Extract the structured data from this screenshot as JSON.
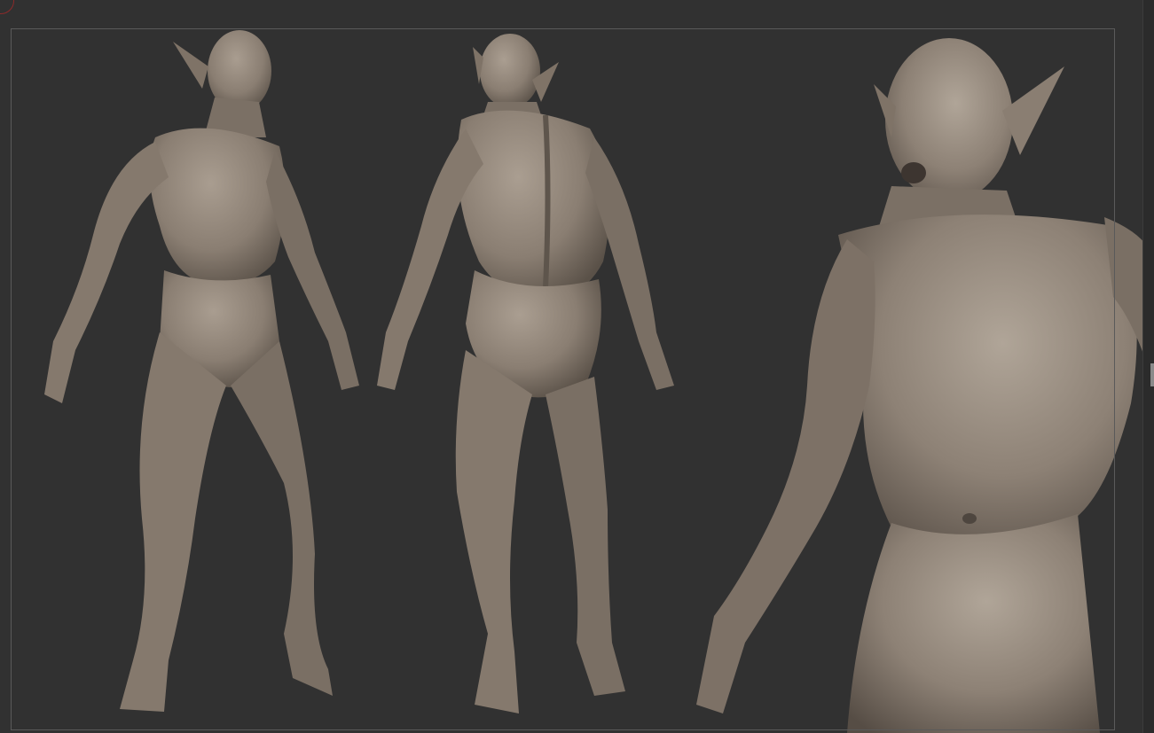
{
  "viewport": {
    "background": "#313131",
    "frame_color": "#5a5a5a",
    "corner_mark_color": "#8c2a2a"
  },
  "sculpt": {
    "material_color": "#8a7e72",
    "shadow_color": "#5b5249",
    "highlight_color": "#b0a598",
    "views": [
      "front-three-quarter",
      "back-three-quarter",
      "close-up"
    ]
  }
}
